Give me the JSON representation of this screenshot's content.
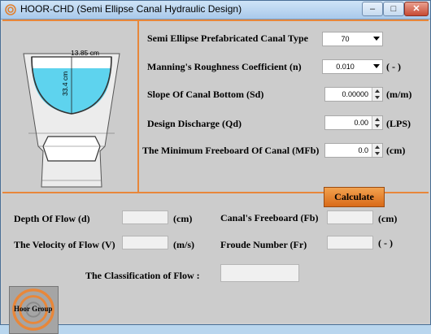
{
  "window": {
    "title": "HOOR-CHD (Semi Ellipse Canal Hydraulic Design)"
  },
  "titlebar_buttons": {
    "minimize": "–",
    "maximize": "□",
    "close": "✕"
  },
  "diagram": {
    "width_label": "13.85 cm",
    "height_label": "33.4 cm"
  },
  "inputs": {
    "canal_type": {
      "label": "Semi Ellipse Prefabricated Canal Type",
      "value": "70"
    },
    "roughness": {
      "label": "Manning's Roughness Coefficient (n)",
      "value": "0.010",
      "unit": "( - )"
    },
    "slope": {
      "label": "Slope Of Canal Bottom (Sd)",
      "value": "0.00000",
      "unit": "(m/m)"
    },
    "discharge": {
      "label": "Design Discharge (Qd)",
      "value": "0.00",
      "unit": "(LPS)"
    },
    "min_freeboard": {
      "label": "The Minimum Freeboard Of Canal (MFb)",
      "value": "0.0",
      "unit": "(cm)"
    }
  },
  "calculate_button": "Calculate",
  "results": {
    "depth": {
      "label": "Depth Of Flow (d)",
      "unit": "(cm)"
    },
    "velocity": {
      "label": "The Velocity of  Flow (V)",
      "unit": "(m/s)"
    },
    "freeboard": {
      "label": "Canal's Freeboard (Fb)",
      "unit": "(cm)"
    },
    "froude": {
      "label": "Froude Number (Fr)",
      "unit": "( - )"
    },
    "classification": {
      "label": "The Classification of Flow :"
    }
  },
  "logo": {
    "text": "Hoor Group"
  },
  "colors": {
    "accent_orange": "#e8873a",
    "water": "#5ed3ee",
    "button_orange": "#e07a26"
  }
}
